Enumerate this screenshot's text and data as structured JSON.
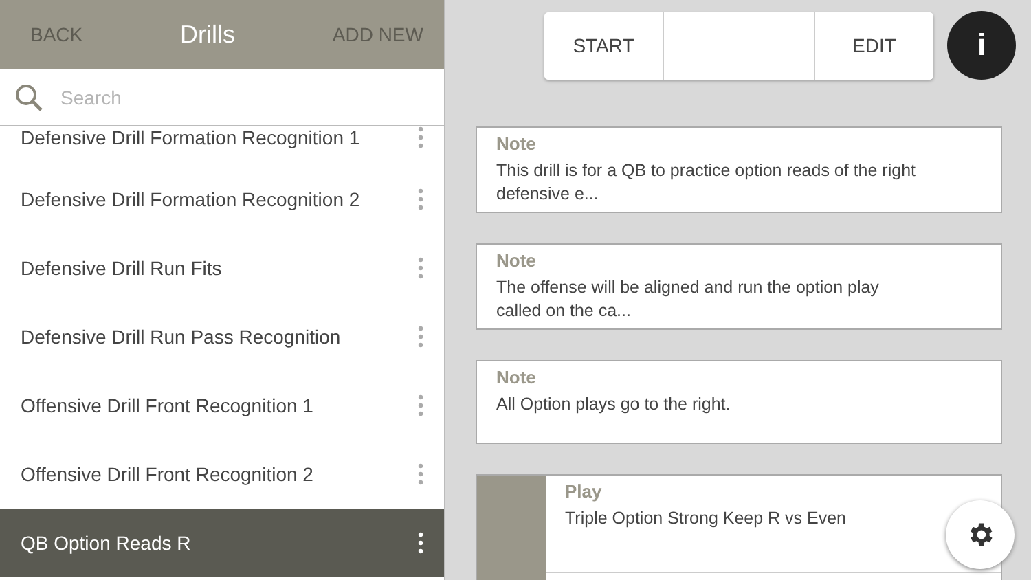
{
  "header": {
    "back": "BACK",
    "title": "Drills",
    "add": "ADD NEW"
  },
  "search": {
    "placeholder": "Search"
  },
  "drills": [
    {
      "name": "Defensive Drill Formation Recognition 1",
      "selected": false
    },
    {
      "name": "Defensive Drill Formation Recognition 2",
      "selected": false
    },
    {
      "name": "Defensive Drill Run Fits",
      "selected": false
    },
    {
      "name": "Defensive Drill Run Pass Recognition",
      "selected": false
    },
    {
      "name": "Offensive Drill Front Recognition 1",
      "selected": false
    },
    {
      "name": "Offensive Drill Front Recognition 2",
      "selected": false
    },
    {
      "name": "QB Option Reads R",
      "selected": true
    }
  ],
  "toolbar": {
    "start": "START",
    "edit": "EDIT",
    "info": "i"
  },
  "cards": [
    {
      "kind": "note",
      "label": "Note",
      "text": "This drill is for a QB to practice option reads of the right defensive e..."
    },
    {
      "kind": "note",
      "label": "Note",
      "text": "The offense will be aligned and run the option play called on the ca..."
    },
    {
      "kind": "note",
      "label": "Note",
      "text": "All Option plays go to the right."
    },
    {
      "kind": "play",
      "label": "Play",
      "text": "Triple Option Strong Keep R vs Even"
    }
  ]
}
